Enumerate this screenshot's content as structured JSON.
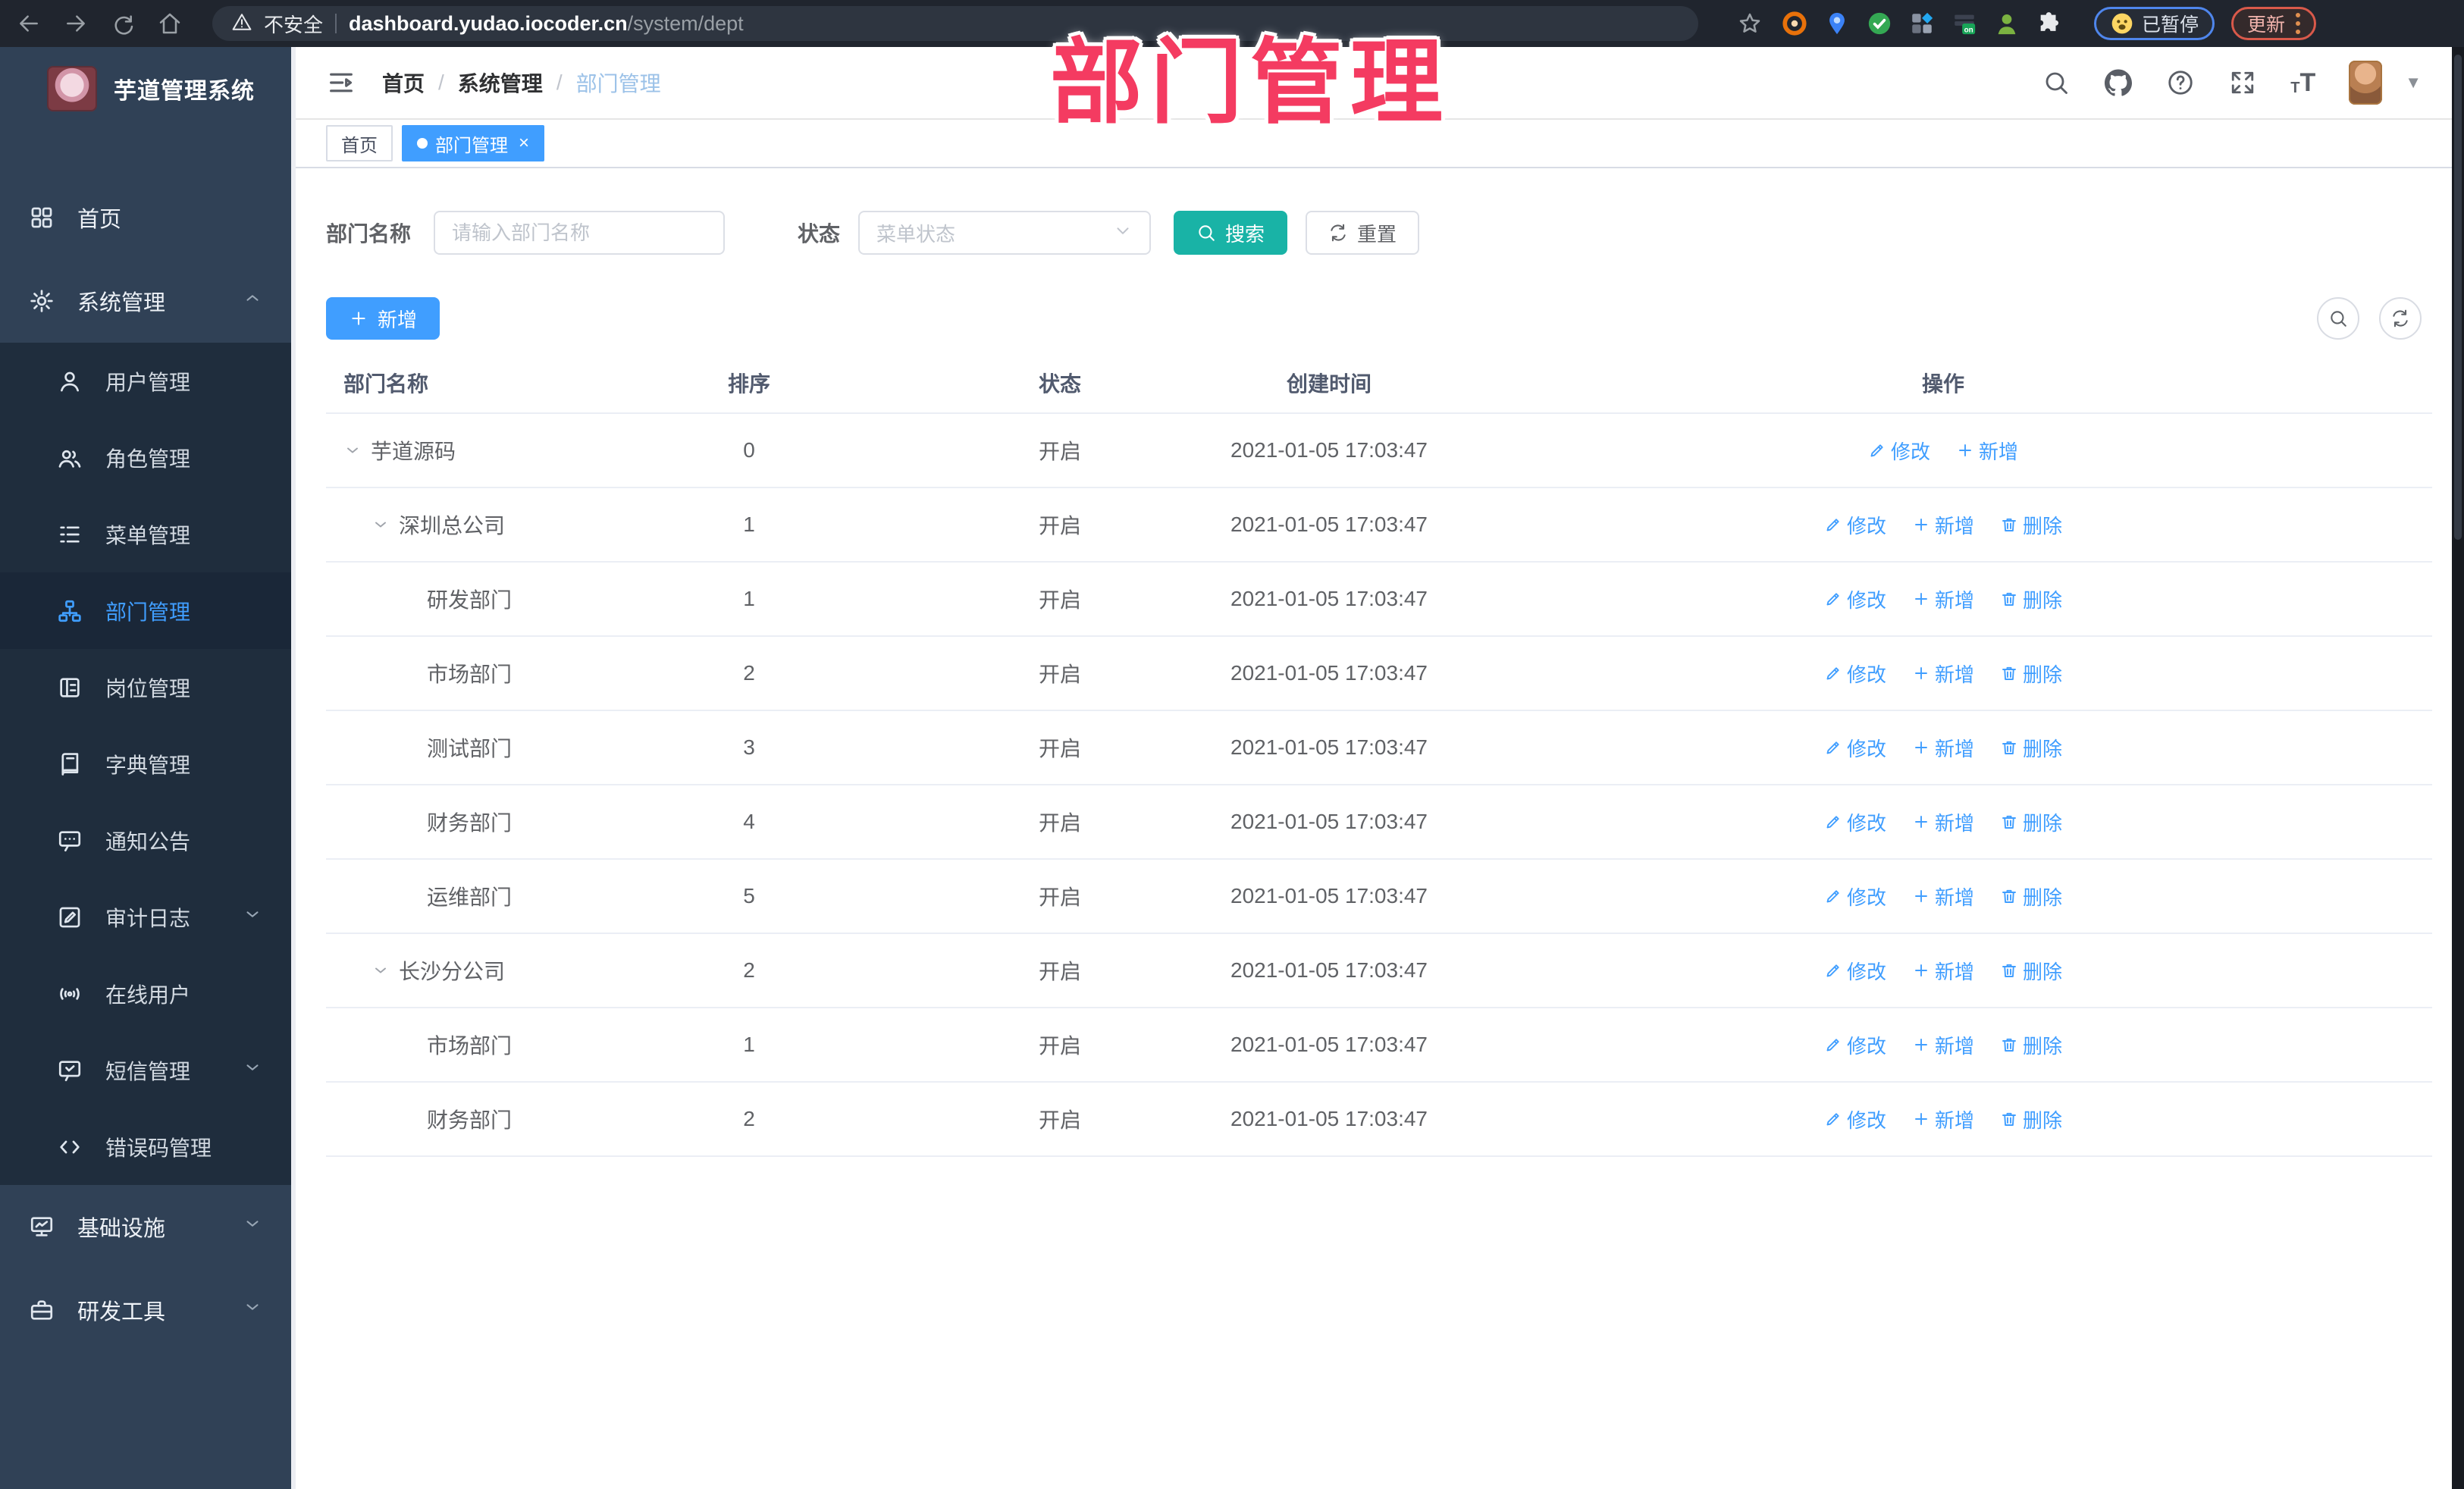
{
  "browser": {
    "security_label": "不安全",
    "url_host": "dashboard.yudao.iocoder.cn",
    "url_path": "/system/dept",
    "paused_label": "已暂停",
    "update_label": "更新"
  },
  "overlay_title": "部门管理",
  "sidebar": {
    "app_title": "芋道管理系统",
    "menu": [
      {
        "label": "首页",
        "icon": "home-icon",
        "level": 1
      },
      {
        "label": "系统管理",
        "icon": "gear-icon",
        "level": 1,
        "chevron": "up"
      },
      {
        "label": "用户管理",
        "icon": "user-icon",
        "level": 2
      },
      {
        "label": "角色管理",
        "icon": "roles-icon",
        "level": 2
      },
      {
        "label": "菜单管理",
        "icon": "menu-list-icon",
        "level": 2
      },
      {
        "label": "部门管理",
        "icon": "dept-tree-icon",
        "level": 2,
        "active": true
      },
      {
        "label": "岗位管理",
        "icon": "post-icon",
        "level": 2
      },
      {
        "label": "字典管理",
        "icon": "dict-icon",
        "level": 2
      },
      {
        "label": "通知公告",
        "icon": "announcement-icon",
        "level": 2
      },
      {
        "label": "审计日志",
        "icon": "audit-log-icon",
        "level": 2,
        "chevron": "down"
      },
      {
        "label": "在线用户",
        "icon": "online-user-icon",
        "level": 2
      },
      {
        "label": "短信管理",
        "icon": "sms-icon",
        "level": 2,
        "chevron": "down"
      },
      {
        "label": "错误码管理",
        "icon": "error-code-icon",
        "level": 2
      },
      {
        "label": "基础设施",
        "icon": "infra-icon",
        "level": 1,
        "chevron": "down"
      },
      {
        "label": "研发工具",
        "icon": "dev-tools-icon",
        "level": 1,
        "chevron": "down"
      }
    ]
  },
  "header": {
    "breadcrumb": [
      "首页",
      "系统管理",
      "部门管理"
    ]
  },
  "tags": [
    {
      "label": "首页",
      "active": false,
      "closable": false
    },
    {
      "label": "部门管理",
      "active": true,
      "closable": true
    }
  ],
  "search": {
    "name_label": "部门名称",
    "name_placeholder": "请输入部门名称",
    "status_label": "状态",
    "status_placeholder": "菜单状态",
    "search_label": "搜索",
    "reset_label": "重置"
  },
  "toolbar": {
    "add_label": "新增"
  },
  "table": {
    "columns": [
      "部门名称",
      "排序",
      "状态",
      "创建时间",
      "操作"
    ],
    "action_labels": {
      "edit": "修改",
      "add": "新增",
      "delete": "删除"
    },
    "rows": [
      {
        "name": "芋道源码",
        "level": 1,
        "expandable": true,
        "sort": "0",
        "status": "开启",
        "time": "2021-01-05 17:03:47",
        "actions": [
          "edit",
          "add"
        ]
      },
      {
        "name": "深圳总公司",
        "level": 2,
        "expandable": true,
        "sort": "1",
        "status": "开启",
        "time": "2021-01-05 17:03:47",
        "actions": [
          "edit",
          "add",
          "delete"
        ]
      },
      {
        "name": "研发部门",
        "level": 3,
        "expandable": false,
        "sort": "1",
        "status": "开启",
        "time": "2021-01-05 17:03:47",
        "actions": [
          "edit",
          "add",
          "delete"
        ]
      },
      {
        "name": "市场部门",
        "level": 3,
        "expandable": false,
        "sort": "2",
        "status": "开启",
        "time": "2021-01-05 17:03:47",
        "actions": [
          "edit",
          "add",
          "delete"
        ]
      },
      {
        "name": "测试部门",
        "level": 3,
        "expandable": false,
        "sort": "3",
        "status": "开启",
        "time": "2021-01-05 17:03:47",
        "actions": [
          "edit",
          "add",
          "delete"
        ]
      },
      {
        "name": "财务部门",
        "level": 3,
        "expandable": false,
        "sort": "4",
        "status": "开启",
        "time": "2021-01-05 17:03:47",
        "actions": [
          "edit",
          "add",
          "delete"
        ]
      },
      {
        "name": "运维部门",
        "level": 3,
        "expandable": false,
        "sort": "5",
        "status": "开启",
        "time": "2021-01-05 17:03:47",
        "actions": [
          "edit",
          "add",
          "delete"
        ]
      },
      {
        "name": "长沙分公司",
        "level": 2,
        "expandable": true,
        "sort": "2",
        "status": "开启",
        "time": "2021-01-05 17:03:47",
        "actions": [
          "edit",
          "add",
          "delete"
        ]
      },
      {
        "name": "市场部门",
        "level": 3,
        "expandable": false,
        "sort": "1",
        "status": "开启",
        "time": "2021-01-05 17:03:47",
        "actions": [
          "edit",
          "add",
          "delete"
        ]
      },
      {
        "name": "财务部门",
        "level": 3,
        "expandable": false,
        "sort": "2",
        "status": "开启",
        "time": "2021-01-05 17:03:47",
        "actions": [
          "edit",
          "add",
          "delete"
        ]
      }
    ]
  },
  "colors": {
    "primary_blue": "#409EFF",
    "search_teal": "#19b3a6",
    "overlay_pink": "#f43b61",
    "sidebar_bg": "#304156",
    "submenu_bg": "#1f2d3d",
    "browser_bar_bg": "#20252e",
    "table_border": "#ebeef5",
    "text_main": "#606266"
  }
}
